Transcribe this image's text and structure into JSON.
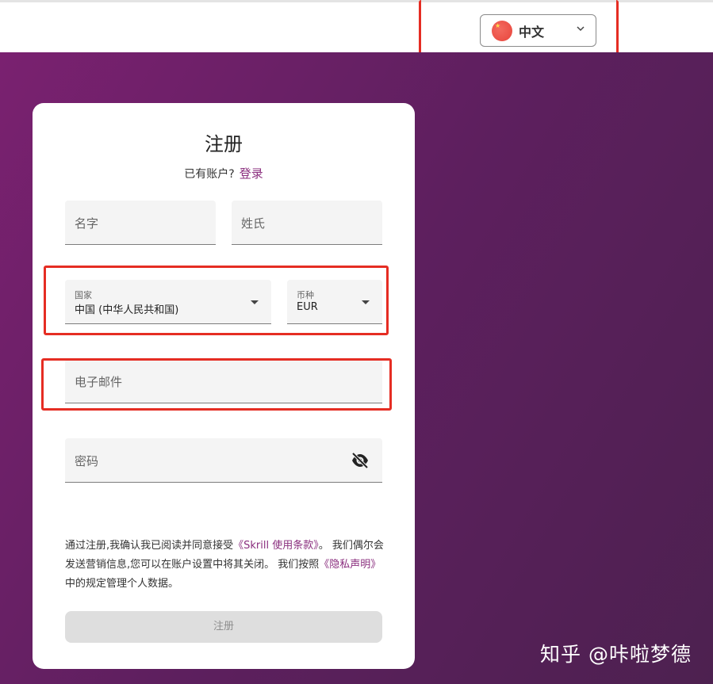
{
  "language_selector": {
    "label": "中文",
    "flag_icon": "china-flag-icon"
  },
  "form": {
    "title": "注册",
    "have_account_text": "已有账户?",
    "login_link": "登录",
    "first_name_placeholder": "名字",
    "last_name_placeholder": "姓氏",
    "country_label": "国家",
    "country_value": "中国 (中华人民共和国)",
    "currency_label": "币种",
    "currency_value": "EUR",
    "email_placeholder": "电子邮件",
    "password_placeholder": "密码",
    "terms_text_1": "通过注册,我确认我已阅读并同意接受",
    "terms_link": "《Skrill 使用条款》",
    "terms_text_2": "。 我们偶尔会发送营销信息,您可以在账户设置中将其关闭。 我们按照",
    "privacy_link": "《隐私声明》",
    "terms_text_3": "中的规定管理个人数据。",
    "submit_label": "注册"
  },
  "watermark": "知乎 @咔啦梦德",
  "colors": {
    "accent": "#8a2e7e",
    "background": "#5a2157",
    "highlight": "#e52d23"
  }
}
